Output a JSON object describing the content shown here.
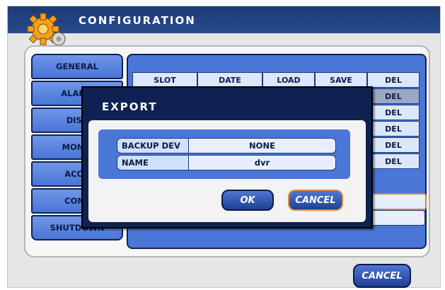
{
  "window": {
    "title": "CONFIGURATION"
  },
  "sidebar": {
    "items": [
      {
        "label": "GENERAL"
      },
      {
        "label": "ALARM"
      },
      {
        "label": "DISP"
      },
      {
        "label": "MONIT"
      },
      {
        "label": "ACCO"
      },
      {
        "label": "CONF"
      },
      {
        "label": "SHUTDOWN"
      }
    ]
  },
  "table": {
    "headers": [
      "SLOT",
      "DATE",
      "LOAD",
      "SAVE",
      "DEL"
    ],
    "rows": [
      {
        "del": "DEL"
      },
      {
        "del": "DEL"
      },
      {
        "del": "DEL"
      },
      {
        "del": "DEL"
      },
      {
        "del": "DEL"
      }
    ]
  },
  "footer": {
    "cancel_label": "CANCEL"
  },
  "dialog": {
    "title": "EXPORT",
    "fields": [
      {
        "label": "BACKUP DEV",
        "value": "NONE"
      },
      {
        "label": "NAME",
        "value": "dvr"
      }
    ],
    "ok_label": "OK",
    "cancel_label": "CANCEL"
  },
  "colors": {
    "accent": "#4a76d7",
    "titlebar": "#1c3a77",
    "focus": "#e08a3a"
  }
}
